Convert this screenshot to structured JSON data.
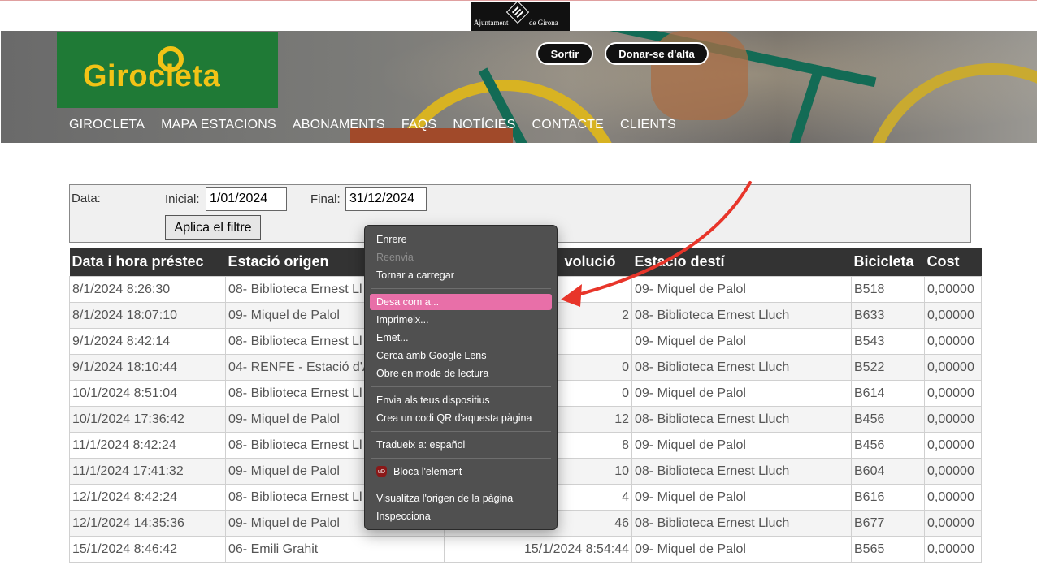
{
  "top_banner": {
    "left_text": "Ajuntament",
    "right_text": "de Girona"
  },
  "header": {
    "logo_text": "Girocleta",
    "buttons": {
      "sortir": "Sortir",
      "alta": "Donar-se d'alta"
    },
    "nav": [
      "GIROCLETA",
      "MAPA ESTACIONS",
      "ABONAMENTS",
      "FAQS",
      "NOTÍCIES",
      "CONTACTE",
      "CLIENTS"
    ]
  },
  "filter": {
    "data_label": "Data:",
    "inicial_label": "Inicial:",
    "inicial_value": "1/01/2024",
    "final_label": "Final:",
    "final_value": "31/12/2024",
    "apply_label": "Aplica el filtre"
  },
  "table": {
    "headers": [
      "Data i hora préstec",
      "Estació origen",
      "Data i hora devolució",
      "Estacio destí",
      "Bicicleta",
      "Cost"
    ],
    "visible_headers": [
      "Data i hora préstec",
      "Estació origen",
      "volució",
      "Estacio destí",
      "Bicicleta",
      "Cost"
    ],
    "rows": [
      [
        "8/1/2024 8:26:30",
        "08- Biblioteca Ernest Ll",
        "",
        "09- Miquel de Palol",
        "B518",
        "0,00000"
      ],
      [
        "8/1/2024 18:07:10",
        "09- Miquel de Palol",
        "2",
        "08- Biblioteca Ernest Lluch",
        "B633",
        "0,00000"
      ],
      [
        "9/1/2024 8:42:14",
        "08- Biblioteca Ernest Ll",
        "",
        "09- Miquel de Palol",
        "B543",
        "0,00000"
      ],
      [
        "9/1/2024 18:10:44",
        "04- RENFE - Estació d'A",
        "0",
        "08- Biblioteca Ernest Lluch",
        "B522",
        "0,00000"
      ],
      [
        "10/1/2024 8:51:04",
        "08- Biblioteca Ernest Ll",
        "0",
        "09- Miquel de Palol",
        "B614",
        "0,00000"
      ],
      [
        "10/1/2024 17:36:42",
        "09- Miquel de Palol",
        "12",
        "08- Biblioteca Ernest Lluch",
        "B456",
        "0,00000"
      ],
      [
        "11/1/2024 8:42:24",
        "08- Biblioteca Ernest Ll",
        "8",
        "09- Miquel de Palol",
        "B456",
        "0,00000"
      ],
      [
        "11/1/2024 17:41:32",
        "09- Miquel de Palol",
        "10",
        "08- Biblioteca Ernest Lluch",
        "B604",
        "0,00000"
      ],
      [
        "12/1/2024 8:42:24",
        "08- Biblioteca Ernest Ll",
        "4",
        "09- Miquel de Palol",
        "B616",
        "0,00000"
      ],
      [
        "12/1/2024 14:35:36",
        "09- Miquel de Palol",
        "46",
        "08- Biblioteca Ernest Lluch",
        "B677",
        "0,00000"
      ],
      [
        "15/1/2024 8:46:42",
        "06- Emili Grahit",
        "15/1/2024 8:54:44",
        "09- Miquel de Palol",
        "B565",
        "0,00000"
      ]
    ]
  },
  "context_menu": {
    "items": [
      {
        "label": "Enrere",
        "disabled": false
      },
      {
        "label": "Reenvia",
        "disabled": true
      },
      {
        "label": "Tornar a carregar",
        "disabled": false
      },
      {
        "label": "Desa com a...",
        "disabled": false,
        "highlighted": true
      },
      {
        "label": "Imprimeix...",
        "disabled": false
      },
      {
        "label": "Emet...",
        "disabled": false
      },
      {
        "label": "Cerca amb Google Lens",
        "disabled": false
      },
      {
        "label": "Obre en mode de lectura",
        "disabled": false
      },
      {
        "label": "Envia als teus dispositius",
        "disabled": false
      },
      {
        "label": "Crea un codi QR d'aquesta pàgina",
        "disabled": false
      },
      {
        "label": "Tradueix a: español",
        "disabled": false
      },
      {
        "label": "Bloca l'element",
        "disabled": false
      },
      {
        "label": "Visualitza l'origen de la pàgina",
        "disabled": false
      },
      {
        "label": "Inspecciona",
        "disabled": false
      }
    ],
    "ublock_icon_text": "uD"
  },
  "colors": {
    "accent_highlight": "#e86fa8",
    "logo_green": "#1f7a36",
    "logo_yellow": "#f2c316",
    "arrow_red": "#e8352a"
  }
}
